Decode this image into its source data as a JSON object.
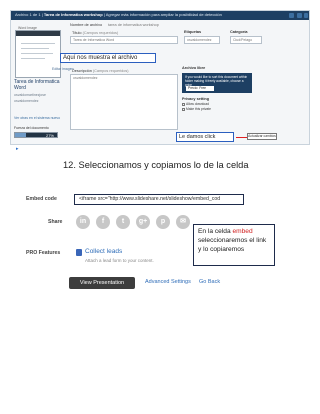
{
  "screenshot1": {
    "breadcrumb": {
      "prefix": "Archivo 1 de 1",
      "title": "Tarea de Informatica workshop",
      "suffix": "| Agregar más información para ampliar la posibilidad de detección"
    },
    "left": {
      "thumbnail_label": "Word Image",
      "change_image_link": "Editar imagen",
      "doc_title": "Tarea de Informatica Word",
      "author": "osvaldomartinezjose",
      "org": "osvaldomendez",
      "more_link": "Ver otras en el sistema nuevo",
      "progress_label": "Fuerza del documento",
      "progress_value": 0.27,
      "progress_text": "27%"
    },
    "middle": {
      "filename_label": "Nombre de archivo",
      "filename_value": "tarea de informatica workshop",
      "title_label": "Título",
      "title_hint": "(Campos requeridos)",
      "title_value": "Tarea de Informatica Word",
      "description_label": "Descripción",
      "description_hint": "(Campos requeridos)",
      "description_value": "osvaldomendez"
    },
    "right": {
      "tags_label": "Etiquetas",
      "tags_value": "osvaldomendez",
      "category_label": "Categoría",
      "category_value": "Ciud/Pelago",
      "privacy_label": "Archivo libre",
      "privacy_text": "If you would like to sort this document within folder making it freely available, choose a price",
      "privacy_select_label": "Precio",
      "privacy_select_value": "Free",
      "settings_label": "Privacy setting",
      "check1": "Allow download",
      "check2": "Make this private"
    },
    "callout_middle": "Aquí nos muestra el archivo",
    "callout_click": "Le damos click",
    "update_button": "Actualizar cambios"
  },
  "step_heading": "12.  Seleccionamos y copiamos lo de la celda",
  "screenshot2": {
    "embed_label": "Embed code",
    "embed_value": "<iframe src=\"http://www.slideshare.net/slideshow/embed_cod",
    "share_label": "Share",
    "share_icons": [
      "in",
      "f",
      "t",
      "g+",
      "p",
      "✉"
    ],
    "pro_label": "PRO Features",
    "collect_link": "Collect leads",
    "collect_sub": "Attach a lead form to your content.",
    "view_button": "View Presentation",
    "advanced_link": "Advanced Settings",
    "back_link": "Go Back"
  },
  "callout_embed": {
    "line1a": "En la celda ",
    "line1b": "embed",
    "line2": "seleccionaremos  el link",
    "line3": "y lo copiaremos"
  },
  "colors": {
    "nav_blue": "#1d3f63",
    "callout_border": "#2b5fbf",
    "link_blue": "#2f6db8",
    "highlight_red": "#d02020"
  }
}
